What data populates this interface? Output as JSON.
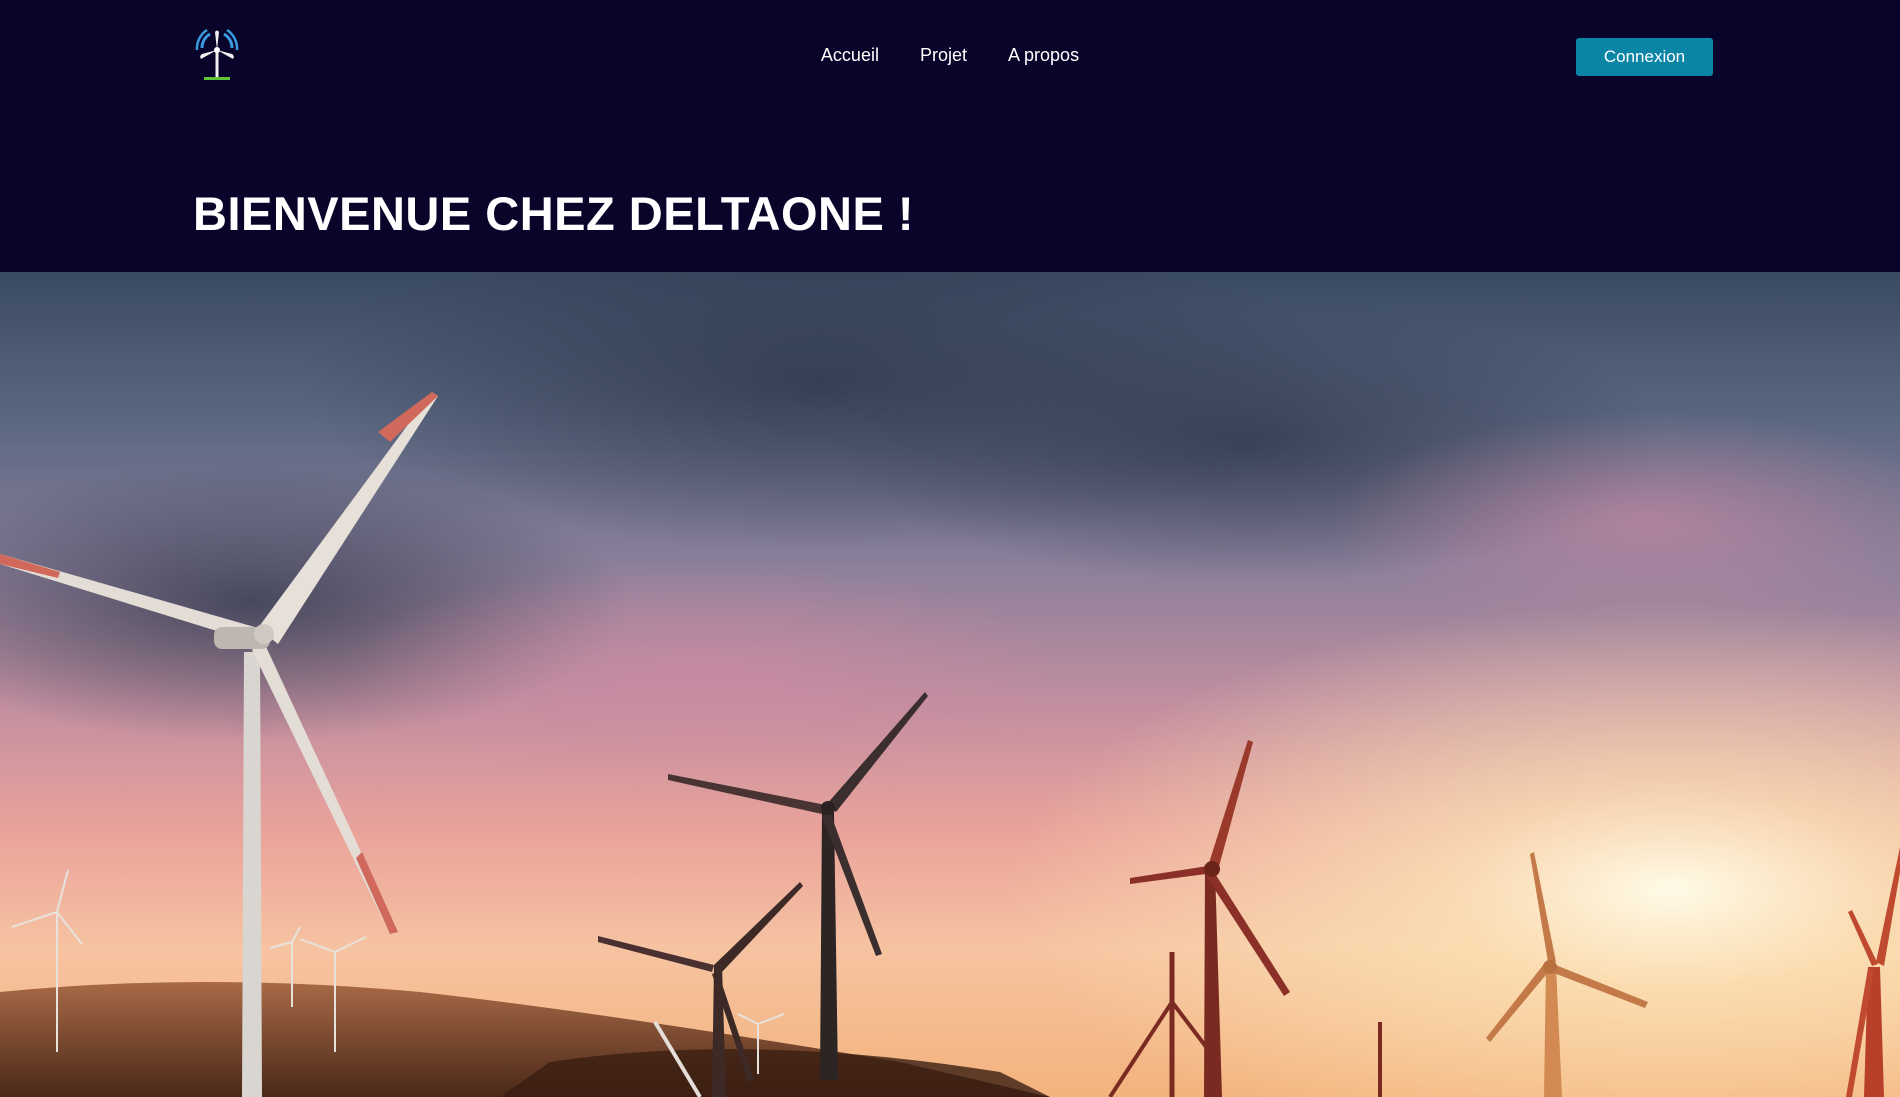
{
  "header": {
    "logo_alt": "DeltaOne wind turbine logo",
    "nav": [
      {
        "label": "Accueil"
      },
      {
        "label": "Projet"
      },
      {
        "label": "A propos"
      }
    ],
    "login_label": "Connexion"
  },
  "main": {
    "title": "BIENVENUE CHEZ DELTAONE !"
  },
  "colors": {
    "background": "#08042a",
    "accent": "#0a85a6"
  }
}
